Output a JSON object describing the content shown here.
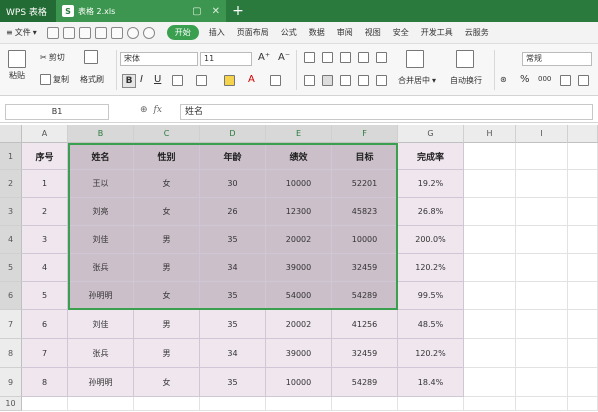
{
  "titlebar": {
    "app_name": "WPS 表格",
    "doc_name": "表格 2.xls",
    "pin": "▢",
    "close": "✕",
    "new_tab": "+"
  },
  "menubar": {
    "file": "文件",
    "file_arrow": "▾",
    "items": [
      "开始",
      "插入",
      "页面布局",
      "公式",
      "数据",
      "审阅",
      "视图",
      "安全",
      "开发工具",
      "云服务"
    ],
    "active_index": 0
  },
  "ribbon": {
    "cut": "剪切",
    "copy": "复制",
    "format_painter": "格式刷",
    "paste": "粘贴",
    "font_name": "宋体",
    "font_size": "11",
    "grow_font": "A⁺",
    "shrink_font": "A⁻",
    "bold": "B",
    "italic": "I",
    "underline": "U",
    "merge_center": "合并居中",
    "wrap_text": "自动换行",
    "number_format": "常规",
    "percent": "%",
    "thousands": "000"
  },
  "formulabar": {
    "namebox": "B1",
    "fx": "fx",
    "value": "姓名"
  },
  "sheet": {
    "columns": [
      "A",
      "B",
      "C",
      "D",
      "E",
      "F",
      "G",
      "H",
      "I"
    ],
    "selected_columns": [
      "B",
      "C",
      "D",
      "E",
      "F"
    ],
    "rows": [
      "1",
      "2",
      "3",
      "4",
      "5",
      "6",
      "7",
      "8",
      "9",
      "10"
    ],
    "selected_rows": [
      "1",
      "2",
      "3",
      "4",
      "5",
      "6"
    ],
    "headers": [
      "序号",
      "姓名",
      "性别",
      "年龄",
      "绩效",
      "目标",
      "完成率"
    ],
    "data": [
      [
        "1",
        "王以",
        "女",
        "30",
        "10000",
        "52201",
        "19.2%"
      ],
      [
        "2",
        "刘亮",
        "女",
        "26",
        "12300",
        "45823",
        "26.8%"
      ],
      [
        "3",
        "刘佳",
        "男",
        "35",
        "20002",
        "10000",
        "200.0%"
      ],
      [
        "4",
        "张兵",
        "男",
        "34",
        "39000",
        "32459",
        "120.2%"
      ],
      [
        "5",
        "孙明明",
        "女",
        "35",
        "54000",
        "54289",
        "99.5%"
      ],
      [
        "6",
        "刘佳",
        "男",
        "35",
        "20002",
        "41256",
        "48.5%"
      ],
      [
        "7",
        "张兵",
        "男",
        "34",
        "39000",
        "32459",
        "120.2%"
      ],
      [
        "8",
        "孙明明",
        "女",
        "35",
        "10000",
        "54289",
        "18.4%"
      ]
    ]
  }
}
